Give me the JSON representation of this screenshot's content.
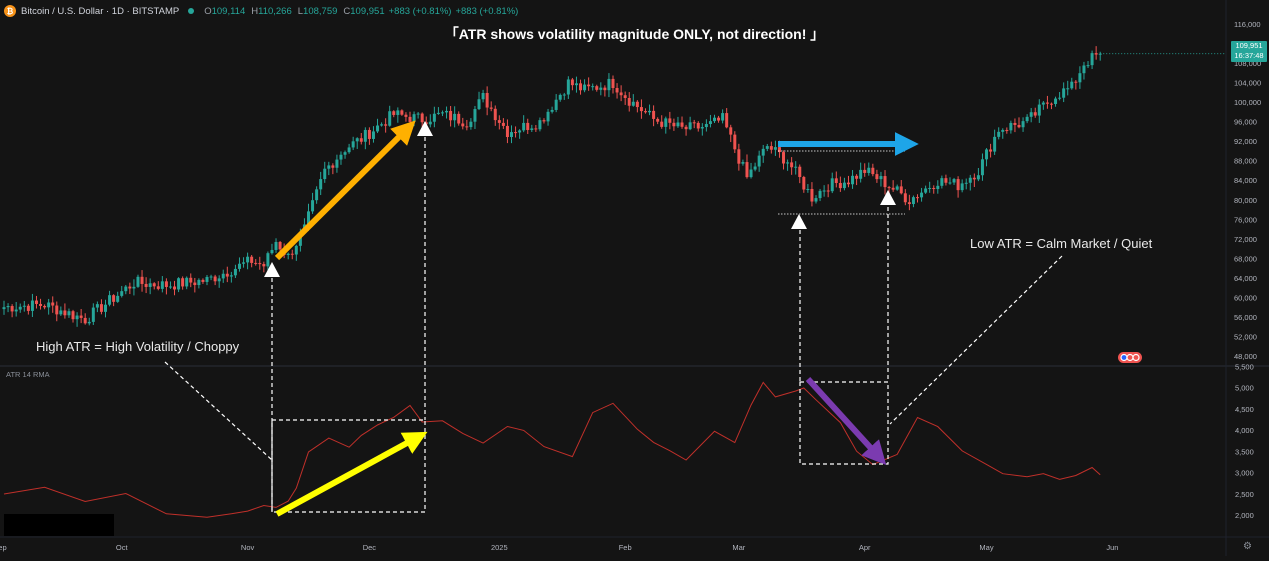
{
  "header": {
    "symbol": "Bitcoin / U.S. Dollar · 1D · BITSTAMP",
    "icon": "bitcoin-icon",
    "open_label": "O",
    "open": "109,114",
    "high_label": "H",
    "high": "110,266",
    "low_label": "L",
    "low": "108,759",
    "close_label": "C",
    "close": "109,951",
    "change": "+883 (+0.81%)",
    "change2": "+883 (+0.81%)"
  },
  "price_tag": {
    "value": "109,951",
    "countdown": "16:37:48"
  },
  "annotations": {
    "title": "「ATR shows volatility magnitude ONLY, not direction! 」",
    "high_atr": "High ATR = High Volatility / Choppy",
    "low_atr": "Low ATR = Calm Market / Quiet"
  },
  "atr_indicator_label": "ATR 14 RMA",
  "colors": {
    "background": "#141414",
    "up": "#26a69a",
    "down": "#ef5350",
    "atr_line": "#c0302a",
    "arrow_orange": "#ffb000",
    "arrow_yellow": "#ffff00",
    "arrow_blue": "#1ea5e8",
    "arrow_purple": "#7b3bb0"
  },
  "chart_data": [
    {
      "type": "candlestick",
      "title": "Bitcoin / U.S. Dollar · 1D · BITSTAMP",
      "y_axis_ticks": [
        116000,
        112000,
        108000,
        104000,
        100000,
        96000,
        92000,
        88000,
        84000,
        80000,
        76000,
        72000,
        68000,
        64000,
        60000,
        56000,
        52000,
        48000
      ],
      "y_axis_labels": [
        "116,000",
        "112,000",
        "108,000",
        "104,000",
        "100,000",
        "96,000",
        "92,000",
        "88,000",
        "84,000",
        "80,000",
        "76,000",
        "72,000",
        "68,000",
        "64,000",
        "60,000",
        "56,000",
        "52,000",
        "48,000"
      ],
      "ylim": [
        45500,
        118500
      ],
      "x_axis_labels": [
        "Sep",
        "Oct",
        "Nov",
        "Dec",
        "2025",
        "Feb",
        "Mar",
        "Apr",
        "May",
        "Jun"
      ],
      "close_path_days": [
        0,
        10,
        20,
        32,
        40,
        50,
        61,
        64,
        67,
        70,
        74,
        79,
        84,
        88,
        96,
        103,
        108,
        114,
        118,
        124,
        132,
        139,
        143,
        150,
        154,
        160,
        167,
        173,
        177,
        183,
        188,
        193,
        199,
        203,
        208,
        212,
        216,
        223,
        230,
        235,
        240,
        245,
        252,
        259,
        263,
        266,
        270
      ],
      "close_path_values": [
        58000,
        58500,
        55500,
        63000,
        62500,
        63500,
        67500,
        66500,
        71500,
        68300,
        74000,
        86000,
        90500,
        92500,
        97500,
        96500,
        97500,
        96000,
        101000,
        94000,
        96000,
        104000,
        102500,
        104000,
        100500,
        96500,
        94500,
        95000,
        96500,
        84500,
        91000,
        88000,
        80500,
        83000,
        84000,
        86000,
        84000,
        80000,
        84000,
        83000,
        86000,
        94500,
        96000,
        101500,
        103000,
        108000,
        109951
      ],
      "last_price": 109951,
      "last_price_label": "109,951",
      "countdown": "16:37:48"
    },
    {
      "type": "line",
      "title": "ATR 14 RMA",
      "series": [
        {
          "name": "ATR 14 RMA",
          "x": [
            0,
            10,
            20,
            30,
            40,
            50,
            56,
            60,
            64,
            67,
            70,
            72,
            75,
            80,
            85,
            88,
            92,
            96,
            100,
            103,
            108,
            113,
            118,
            124,
            128,
            133,
            140,
            145,
            150,
            156,
            160,
            164,
            168,
            175,
            180,
            184,
            187,
            190,
            195,
            197,
            200,
            206,
            210,
            214,
            220,
            225,
            230,
            236,
            242,
            246,
            252,
            256,
            260,
            264,
            268,
            270
          ],
          "y": [
            2500,
            2650,
            2300,
            2500,
            2050,
            1950,
            2050,
            2100,
            2250,
            2200,
            2350,
            2650,
            3500,
            3800,
            3600,
            3900,
            4100,
            4300,
            4600,
            4200,
            4200,
            3900,
            3700,
            4100,
            4000,
            3600,
            3400,
            4400,
            4650,
            4000,
            3700,
            3500,
            3300,
            3950,
            3700,
            4600,
            5100,
            4800,
            4900,
            5000,
            4700,
            4200,
            3500,
            3200,
            3450,
            4300,
            4100,
            3500,
            3200,
            3000,
            2900,
            3000,
            2850,
            2950,
            3100,
            2950
          ]
        }
      ],
      "y_axis_ticks": [
        5500,
        5000,
        4500,
        4000,
        3500,
        3000,
        2500,
        2000
      ],
      "y_axis_labels": [
        "5,500",
        "5,000",
        "4,500",
        "4,000",
        "3,500",
        "3,000",
        "2,500",
        "2,000"
      ],
      "ylim": [
        1700,
        5650
      ],
      "x_axis_labels": [
        "Sep",
        "Oct",
        "Nov",
        "Dec",
        "2025",
        "Feb",
        "Mar",
        "Apr",
        "May",
        "Jun"
      ]
    }
  ]
}
